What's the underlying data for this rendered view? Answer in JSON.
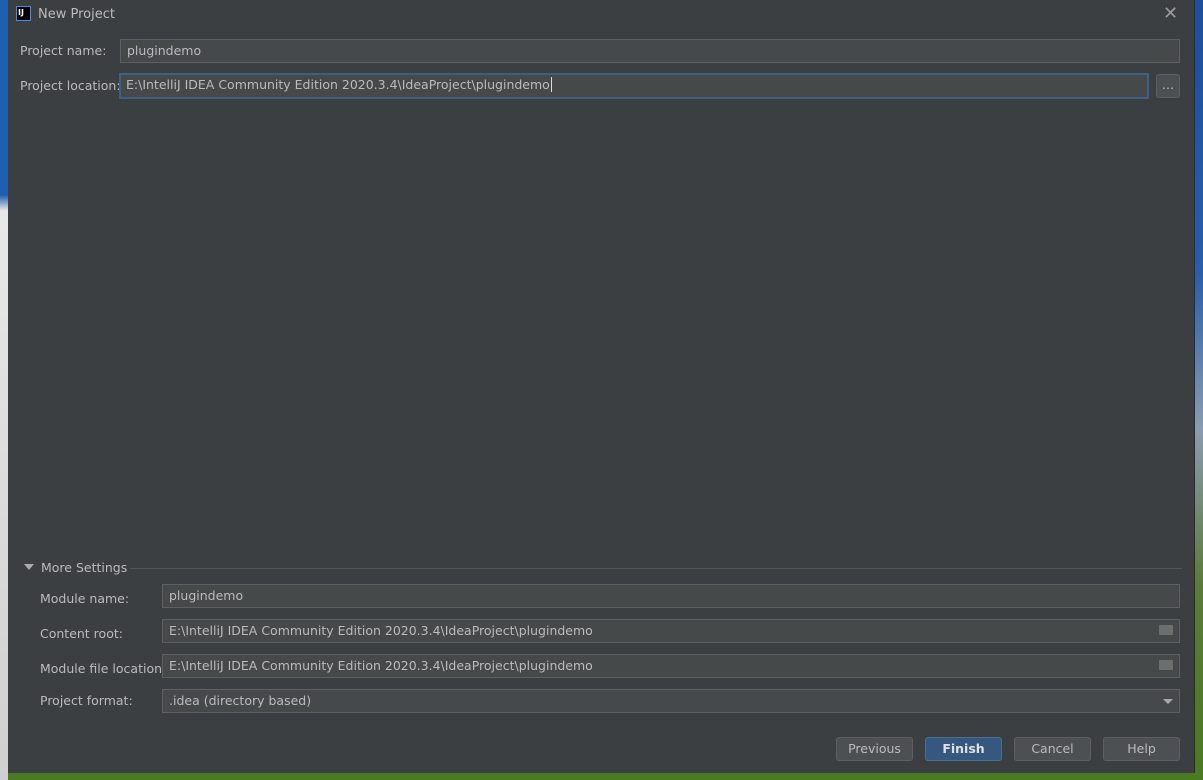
{
  "window": {
    "title": "New Project"
  },
  "project_name": {
    "label": "Project name:",
    "value": "plugindemo"
  },
  "project_location": {
    "label": "Project location:",
    "value": "E:\\IntelliJ IDEA Community Edition 2020.3.4\\IdeaProject\\plugindemo",
    "browse_label": "..."
  },
  "more_settings": {
    "label": "More Settings",
    "expanded": true,
    "module_name": {
      "label": "Module name:",
      "value": "plugindemo"
    },
    "content_root": {
      "label": "Content root:",
      "value": "E:\\IntelliJ IDEA Community Edition 2020.3.4\\IdeaProject\\plugindemo"
    },
    "module_file_location": {
      "label": "Module file location:",
      "value": "E:\\IntelliJ IDEA Community Edition 2020.3.4\\IdeaProject\\plugindemo"
    },
    "project_format": {
      "label": "Project format:",
      "value": ".idea (directory based)"
    }
  },
  "buttons": {
    "previous": "Previous",
    "finish": "Finish",
    "cancel": "Cancel",
    "help": "Help"
  },
  "colors": {
    "dialog_bg": "#3c3f41",
    "primary_button": "#365880",
    "focus_border": "#3d6185"
  }
}
